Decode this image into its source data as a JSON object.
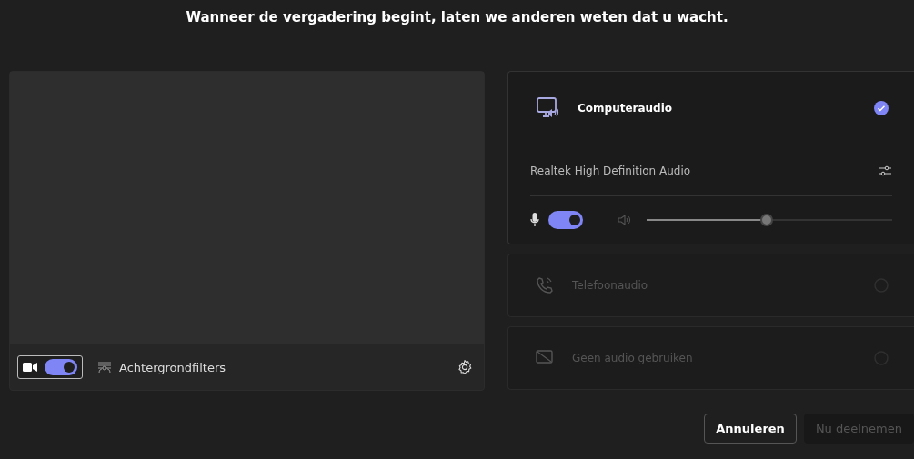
{
  "heading": "Wanneer de vergadering begint, laten we anderen weten dat u wacht.",
  "video": {
    "camera_on": true,
    "background_filters": "Achtergrondfilters"
  },
  "audio_options": [
    {
      "kind": "computer",
      "label": "Computeraudio",
      "selected": true,
      "disabled": false,
      "device": "Realtek High Definition Audio",
      "mic_on": true,
      "volume": {
        "level": 0.49
      }
    },
    {
      "kind": "phone",
      "label": "Telefoonaudio",
      "selected": false,
      "disabled": true
    },
    {
      "kind": "none",
      "label": "Geen audio gebruiken",
      "selected": false,
      "disabled": true
    }
  ],
  "buttons": [
    {
      "label": "Annuleren",
      "disabled": false
    },
    {
      "label": "Nu deelnemen",
      "disabled": true
    }
  ]
}
